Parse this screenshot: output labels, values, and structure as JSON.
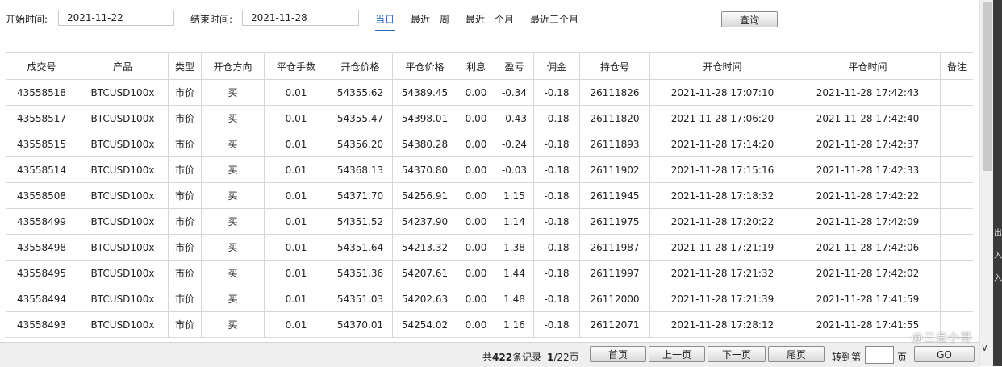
{
  "filter": {
    "start_label": "开始时间:",
    "start_value": "2021-11-22",
    "end_label": "结束时间:",
    "end_value": "2021-11-28",
    "quick_ranges": [
      "当日",
      "最近一周",
      "最近一个月",
      "最近三个月"
    ],
    "active_range": "当日",
    "query_button": "查询"
  },
  "table": {
    "columns": [
      "成交号",
      "产品",
      "类型",
      "开仓方向",
      "平仓手数",
      "开仓价格",
      "平仓价格",
      "利息",
      "盈亏",
      "佣金",
      "持仓号",
      "开仓时间",
      "平仓时间",
      "备注"
    ],
    "rows": [
      [
        "43558518",
        "BTCUSD100x",
        "市价",
        "买",
        "0.01",
        "54355.62",
        "54389.45",
        "0.00",
        "-0.34",
        "-0.18",
        "26111826",
        "2021-11-28 17:07:10",
        "2021-11-28 17:42:43",
        ""
      ],
      [
        "43558517",
        "BTCUSD100x",
        "市价",
        "买",
        "0.01",
        "54355.47",
        "54398.01",
        "0.00",
        "-0.43",
        "-0.18",
        "26111820",
        "2021-11-28 17:06:20",
        "2021-11-28 17:42:40",
        ""
      ],
      [
        "43558515",
        "BTCUSD100x",
        "市价",
        "买",
        "0.01",
        "54356.20",
        "54380.28",
        "0.00",
        "-0.24",
        "-0.18",
        "26111893",
        "2021-11-28 17:14:20",
        "2021-11-28 17:42:37",
        ""
      ],
      [
        "43558514",
        "BTCUSD100x",
        "市价",
        "买",
        "0.01",
        "54368.13",
        "54370.80",
        "0.00",
        "-0.03",
        "-0.18",
        "26111902",
        "2021-11-28 17:15:16",
        "2021-11-28 17:42:33",
        ""
      ],
      [
        "43558508",
        "BTCUSD100x",
        "市价",
        "买",
        "0.01",
        "54371.70",
        "54256.91",
        "0.00",
        "1.15",
        "-0.18",
        "26111945",
        "2021-11-28 17:18:32",
        "2021-11-28 17:42:22",
        ""
      ],
      [
        "43558499",
        "BTCUSD100x",
        "市价",
        "买",
        "0.01",
        "54351.52",
        "54237.90",
        "0.00",
        "1.14",
        "-0.18",
        "26111975",
        "2021-11-28 17:20:22",
        "2021-11-28 17:42:09",
        ""
      ],
      [
        "43558498",
        "BTCUSD100x",
        "市价",
        "买",
        "0.01",
        "54351.64",
        "54213.32",
        "0.00",
        "1.38",
        "-0.18",
        "26111987",
        "2021-11-28 17:21:19",
        "2021-11-28 17:42:06",
        ""
      ],
      [
        "43558495",
        "BTCUSD100x",
        "市价",
        "买",
        "0.01",
        "54351.36",
        "54207.61",
        "0.00",
        "1.44",
        "-0.18",
        "26111997",
        "2021-11-28 17:21:32",
        "2021-11-28 17:42:02",
        ""
      ],
      [
        "43558494",
        "BTCUSD100x",
        "市价",
        "买",
        "0.01",
        "54351.03",
        "54202.63",
        "0.00",
        "1.48",
        "-0.18",
        "26112000",
        "2021-11-28 17:21:39",
        "2021-11-28 17:41:59",
        ""
      ],
      [
        "43558493",
        "BTCUSD100x",
        "市价",
        "买",
        "0.01",
        "54370.01",
        "54254.02",
        "0.00",
        "1.16",
        "-0.18",
        "26112071",
        "2021-11-28 17:28:12",
        "2021-11-28 17:41:55",
        ""
      ]
    ]
  },
  "pagination": {
    "total_prefix": "共",
    "total_count": "422",
    "total_suffix": "条记录",
    "current_page": "1",
    "total_pages": "/22页",
    "first": "首页",
    "prev": "上一页",
    "next": "下一页",
    "last": "尾页",
    "goto_label": "转到第",
    "goto_value": "",
    "goto_suffix": "页",
    "go": "GO"
  },
  "watermark": "@三金小哥",
  "edge_glyphs": [
    "出",
    "入",
    "入"
  ]
}
